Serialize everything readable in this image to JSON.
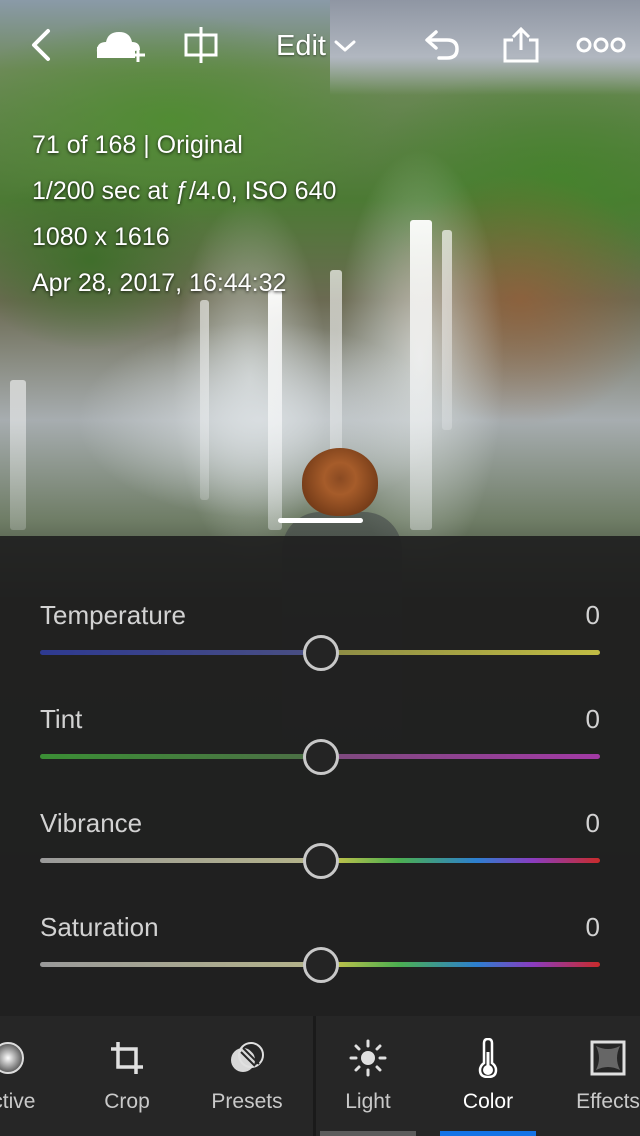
{
  "header": {
    "back_icon": "chevron-left-icon",
    "cloud_icon": "cloud-add-icon",
    "compare_icon": "split-compare-icon",
    "mode_label": "Edit",
    "undo_icon": "undo-icon",
    "share_icon": "share-icon",
    "more_icon": "more-dots-icon"
  },
  "photo_info": {
    "position": "71 of 168 | Original",
    "exposure": "1/200 sec at ƒ/4.0, ISO 640",
    "dimensions": "1080 x 1616",
    "date": "Apr 28, 2017, 16:44:32"
  },
  "panel": {
    "title": "Color",
    "sliders": [
      {
        "label": "Temperature",
        "value": "0",
        "position": 0.5,
        "colors": [
          "#2f3a8f",
          "#b8b447"
        ]
      },
      {
        "label": "Tint",
        "value": "0",
        "position": 0.5,
        "colors": [
          "#3f8f3a",
          "#9c3fa0"
        ]
      },
      {
        "label": "Vibrance",
        "value": "0",
        "position": 0.5,
        "colors": [
          "#aaaaaa",
          "rainbow"
        ]
      },
      {
        "label": "Saturation",
        "value": "0",
        "position": 0.5,
        "colors": [
          "#aaaaaa",
          "rainbow"
        ]
      }
    ]
  },
  "toolbar": {
    "items": [
      {
        "label": "ective",
        "icon": "selective-icon",
        "active": false
      },
      {
        "label": "Crop",
        "icon": "crop-icon",
        "active": false
      },
      {
        "label": "Presets",
        "icon": "presets-icon",
        "active": false
      },
      {
        "label": "Light",
        "icon": "light-icon",
        "active": false
      },
      {
        "label": "Color",
        "icon": "thermometer-icon",
        "active": true
      },
      {
        "label": "Effects",
        "icon": "effects-icon",
        "active": false
      }
    ],
    "accent_color": "#1473e6",
    "light_indicator_color": "#5c5c5c"
  }
}
